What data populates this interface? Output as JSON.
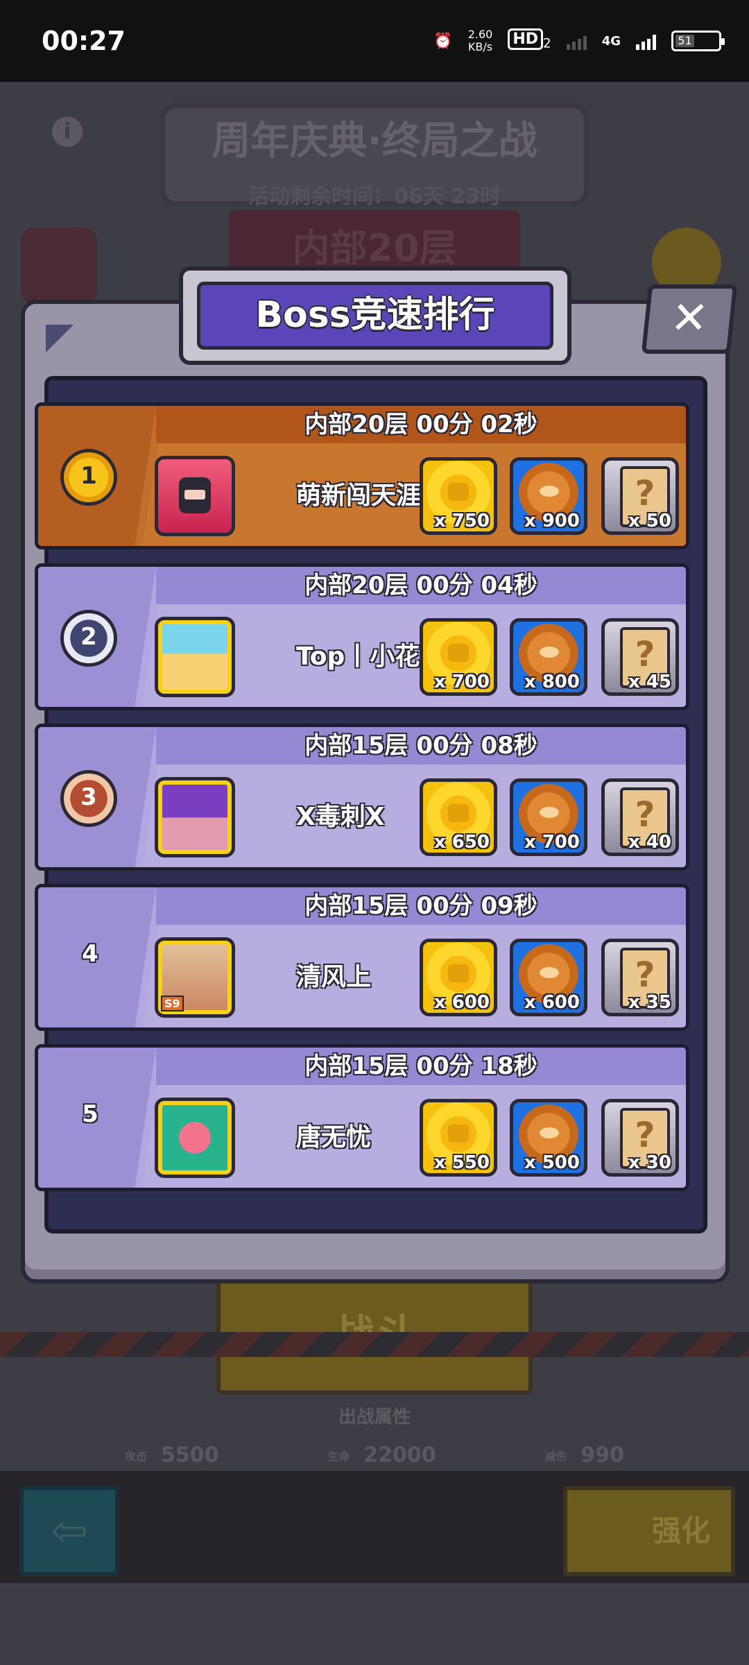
{
  "status_bar": {
    "time": "00:27",
    "net_speed": "2.60",
    "net_unit": "KB/s",
    "hd_label": "HD",
    "hd_sub": "2",
    "network": "4G",
    "battery": "51"
  },
  "background": {
    "title": "周年庆典·终局之战",
    "remaining": "活动剩余时间：06天 23时",
    "floor": "内部20层",
    "fight_button": "战斗",
    "attr_title": "出战属性",
    "stats": [
      {
        "label": "攻击",
        "value": "5500"
      },
      {
        "label": "生命",
        "value": "22000"
      },
      {
        "label": "减伤",
        "value": "990"
      }
    ],
    "enhance_button": "强化"
  },
  "dialog": {
    "title": "Boss竞速排行",
    "close_glyph": "✕",
    "rows": [
      {
        "rank": "1",
        "header": "内部20层 00分 02秒",
        "name": "萌新闯天涯",
        "coin": "x 750",
        "pet": "x 900",
        "scroll": "x 50"
      },
      {
        "rank": "2",
        "header": "内部20层 00分 04秒",
        "name": "Top丨小花",
        "coin": "x 700",
        "pet": "x 800",
        "scroll": "x 45"
      },
      {
        "rank": "3",
        "header": "内部15层 00分 08秒",
        "name": "X毒刺X",
        "coin": "x 650",
        "pet": "x 700",
        "scroll": "x 40"
      },
      {
        "rank": "4",
        "header": "内部15层 00分 09秒",
        "name": "清风上",
        "coin": "x 600",
        "pet": "x 600",
        "scroll": "x 35",
        "avatar_badge": "S9"
      },
      {
        "rank": "5",
        "header": "内部15层 00分 18秒",
        "name": "唐无忧",
        "coin": "x 550",
        "pet": "x 500",
        "scroll": "x 30"
      }
    ]
  }
}
